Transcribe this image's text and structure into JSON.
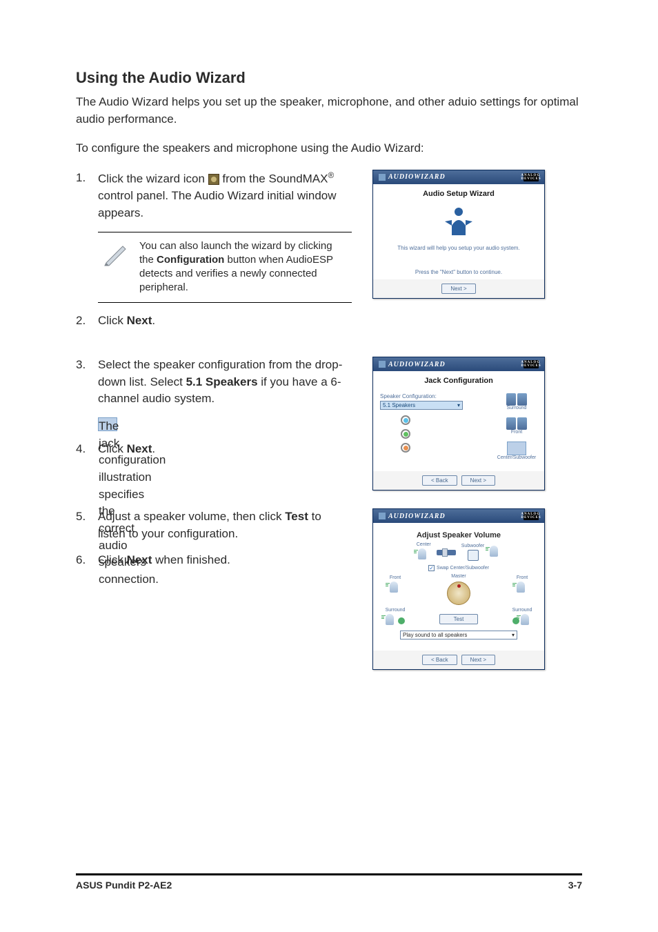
{
  "heading": "Using the Audio Wizard",
  "intro1": "The Audio Wizard helps you set up the speaker, microphone, and other aduio settings for optimal audio performance.",
  "intro2": "To configure the speakers and microphone using the Audio Wizard:",
  "step1": {
    "num": "1.",
    "pre": "Click the wizard icon ",
    "post": " from the SoundMAX",
    "reg": "®",
    "post2": " control panel. The Audio Wizard initial window appears."
  },
  "note": {
    "pre": "You can also launch the wizard by clicking the ",
    "bold": "Configuration",
    "post": " button when AudioESP detects and verifies a newly connected peripheral."
  },
  "step2": {
    "num": "2.",
    "pre": "Click ",
    "bold": "Next",
    "post": "."
  },
  "step3": {
    "num": "3.",
    "pre": "Select the speaker configuration from the drop-down list. Select ",
    "bold": "5.1 Speakers",
    "post": " if you have a 6-channel audio system.",
    "sub": "The jack configuration illustration specifies the correct audio speakers connection."
  },
  "step4": {
    "num": "4.",
    "pre": "Click ",
    "bold": "Next",
    "post": "."
  },
  "step5": {
    "num": "5.",
    "pre": "Adjust a speaker volume, then click ",
    "bold": "Test",
    "post": " to listen to your configuration."
  },
  "step6": {
    "num": "6.",
    "pre": "Click ",
    "bold": "Next",
    "post": " when finished."
  },
  "wizard": {
    "app_title": "AUDIOWIZARD",
    "logo": "ANALOG DEVICES",
    "w1": {
      "title": "Audio Setup Wizard",
      "msg1": "This wizard will help you setup your audio system.",
      "msg2": "Press the \"Next\" button to continue.",
      "next": "Next >"
    },
    "w2": {
      "title": "Jack Configuration",
      "label": "Speaker Configuration:",
      "select": "5.1 Speakers",
      "lbl_surround": "Surround",
      "lbl_front": "Front",
      "lbl_center": "Center/Subwoofer",
      "back": "< Back",
      "next": "Next >",
      "jack_colors": [
        "#5ac0e8",
        "#60c060",
        "#e89050"
      ]
    },
    "w3": {
      "title": "Adjust Speaker Volume",
      "lbl_center": "Center",
      "lbl_sub": "Subwoofer",
      "lbl_front": "Front",
      "lbl_surround": "Surround",
      "swap": "Swap Center/Subwoofer",
      "master": "Master",
      "test": "Test",
      "play": "Play sound to all speakers",
      "back": "< Back",
      "next": "Next >"
    }
  },
  "footer": {
    "left": "ASUS Pundit P2-AE2",
    "right": "3-7"
  },
  "chart_data": null
}
